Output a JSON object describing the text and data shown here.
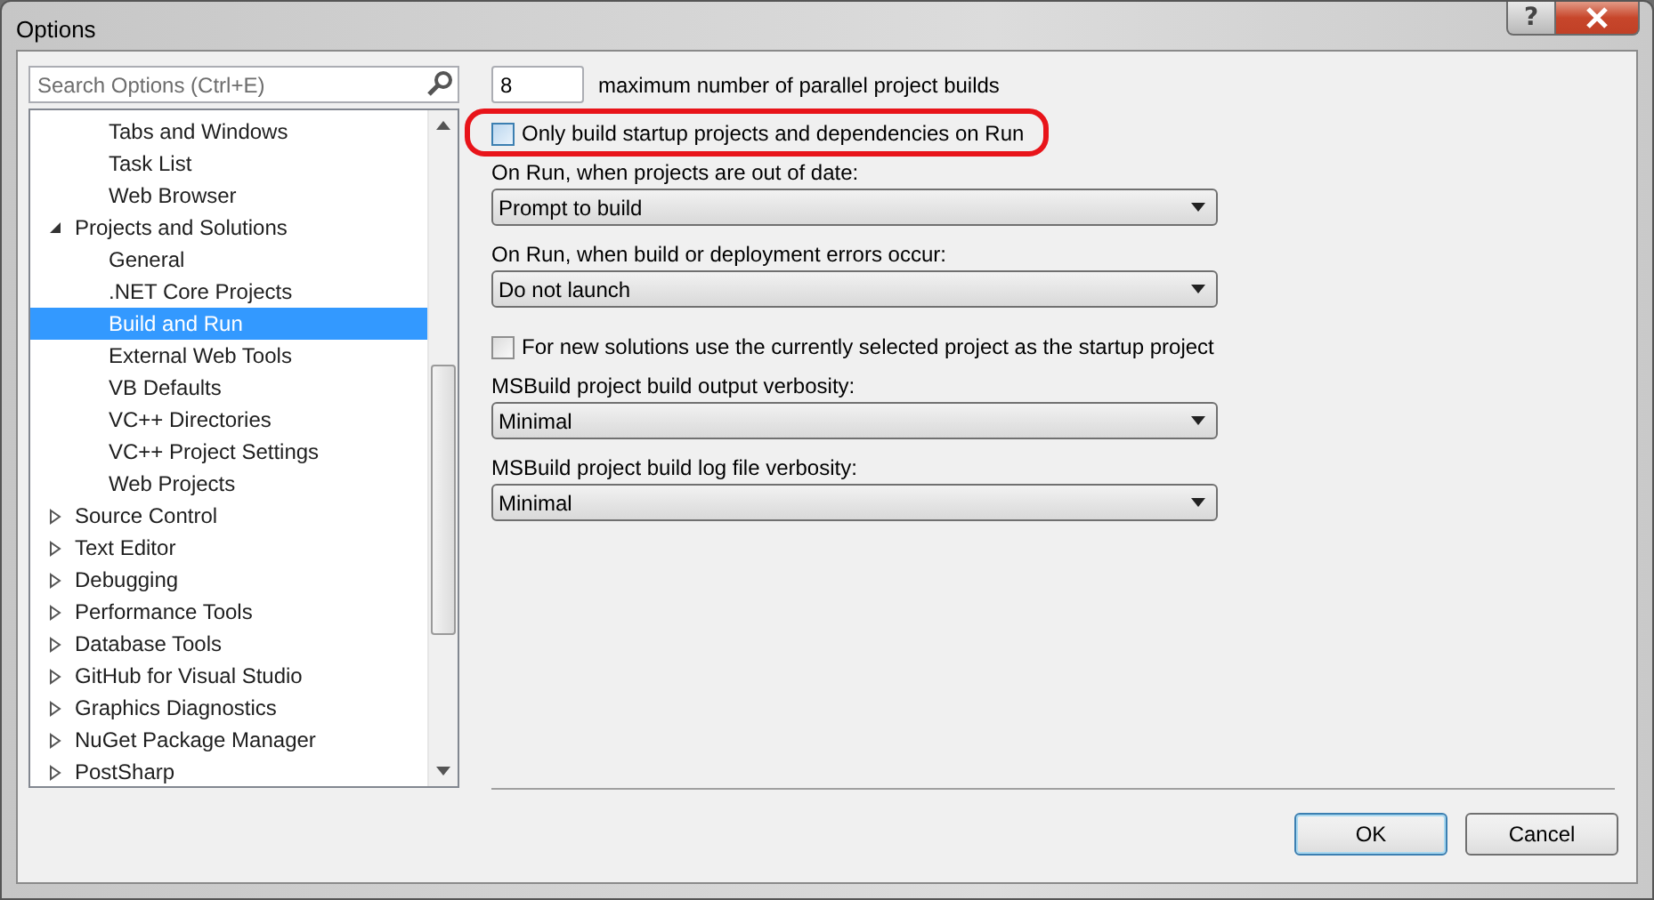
{
  "window": {
    "title": "Options",
    "help_label": "?"
  },
  "search": {
    "placeholder": "Search Options (Ctrl+E)"
  },
  "tree": [
    {
      "children": [
        {
          "label": "Tabs and Windows",
          "selected": false
        },
        {
          "label": "Task List",
          "selected": false
        },
        {
          "label": "Web Browser",
          "selected": false
        }
      ]
    },
    {
      "label": "Projects and Solutions",
      "expanded": true,
      "selected": false,
      "children": [
        {
          "label": "General",
          "selected": false
        },
        {
          "label": ".NET Core Projects",
          "selected": false
        },
        {
          "label": "Build and Run",
          "selected": true
        },
        {
          "label": "External Web Tools",
          "selected": false
        },
        {
          "label": "VB Defaults",
          "selected": false
        },
        {
          "label": "VC++ Directories",
          "selected": false
        },
        {
          "label": "VC++ Project Settings",
          "selected": false
        },
        {
          "label": "Web Projects",
          "selected": false
        }
      ]
    },
    {
      "label": "Source Control",
      "expanded": false,
      "selected": false
    },
    {
      "label": "Text Editor",
      "expanded": false,
      "selected": false
    },
    {
      "label": "Debugging",
      "expanded": false,
      "selected": false
    },
    {
      "label": "Performance Tools",
      "expanded": false,
      "selected": false
    },
    {
      "label": "Database Tools",
      "expanded": false,
      "selected": false
    },
    {
      "label": "GitHub for Visual Studio",
      "expanded": false,
      "selected": false
    },
    {
      "label": "Graphics Diagnostics",
      "expanded": false,
      "selected": false
    },
    {
      "label": "NuGet Package Manager",
      "expanded": false,
      "selected": false
    },
    {
      "label": "PostSharp",
      "expanded": false,
      "selected": false
    }
  ],
  "max_builds": {
    "value": "8",
    "caption": "maximum number of parallel project builds"
  },
  "settings": [
    {
      "kind": "checkbox",
      "label": "Only build startup projects and dependencies on Run",
      "checked": false,
      "highlighted": true
    },
    {
      "kind": "dropdown",
      "label": "On Run, when projects are out of date:",
      "value": "Prompt to build"
    },
    {
      "kind": "dropdown",
      "label": "On Run, when build or deployment errors occur:",
      "value": "Do not launch"
    },
    {
      "kind": "checkbox",
      "label": "For new solutions use the currently selected project as the startup project",
      "checked": false,
      "highlighted": false
    },
    {
      "kind": "dropdown",
      "label": "MSBuild project build output verbosity:",
      "value": "Minimal",
      "spaced": true
    },
    {
      "kind": "dropdown",
      "label": "MSBuild project build log file verbosity:",
      "value": "Minimal"
    }
  ],
  "buttons": [
    {
      "label": "OK",
      "default": true
    },
    {
      "label": "Cancel",
      "default": false
    }
  ]
}
